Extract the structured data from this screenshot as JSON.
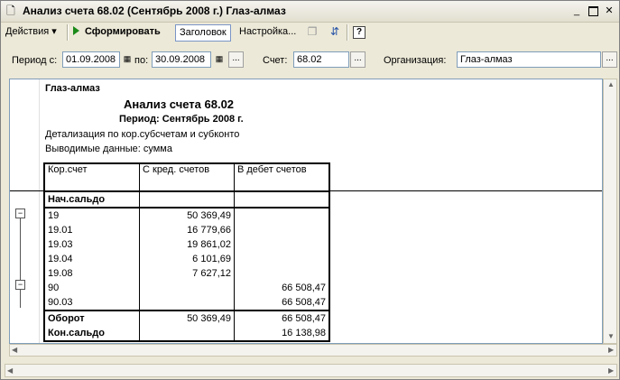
{
  "window": {
    "title": "Анализ счета 68.02 (Сентябрь 2008 г.) Глаз-алмаз",
    "minimize": "_",
    "close": "✕"
  },
  "toolbar": {
    "actions_label": "Действия",
    "form_label": "Сформировать",
    "header_label": "Заголовок",
    "settings_label": "Настройка...",
    "help_label": "?"
  },
  "filter": {
    "period_from_label": "Период с:",
    "period_from_value": "01.09.2008",
    "period_to_label": "по:",
    "period_to_value": "30.09.2008",
    "account_label": "Счет:",
    "account_value": "68.02",
    "org_label": "Организация:",
    "org_value": "Глаз-алмаз",
    "dots": "..."
  },
  "report": {
    "org": "Глаз-алмаз",
    "title": "Анализ счета 68.02",
    "period": "Период: Сентябрь 2008 г.",
    "detail": "Детализация по  кор.субсчетам и субконто",
    "output": "Выводимые данные: сумма",
    "columns": [
      "Кор.счет",
      "С кред. счетов",
      "В дебет счетов"
    ],
    "opening_label": "Нач.сальдо",
    "rows": [
      {
        "account": "19",
        "credit": "50 369,49",
        "debit": ""
      },
      {
        "account": "19.01",
        "credit": "16 779,66",
        "debit": ""
      },
      {
        "account": "19.03",
        "credit": "19 861,02",
        "debit": ""
      },
      {
        "account": "19.04",
        "credit": "6 101,69",
        "debit": ""
      },
      {
        "account": "19.08",
        "credit": "7 627,12",
        "debit": ""
      },
      {
        "account": "90",
        "credit": "",
        "debit": "66 508,47"
      },
      {
        "account": "90.03",
        "credit": "",
        "debit": "66 508,47"
      }
    ],
    "turnover": {
      "label": "Оборот",
      "credit": "50 369,49",
      "debit": "66 508,47"
    },
    "closing": {
      "label": "Кон.сальдо",
      "credit": "",
      "debit": "16 138,98"
    }
  }
}
